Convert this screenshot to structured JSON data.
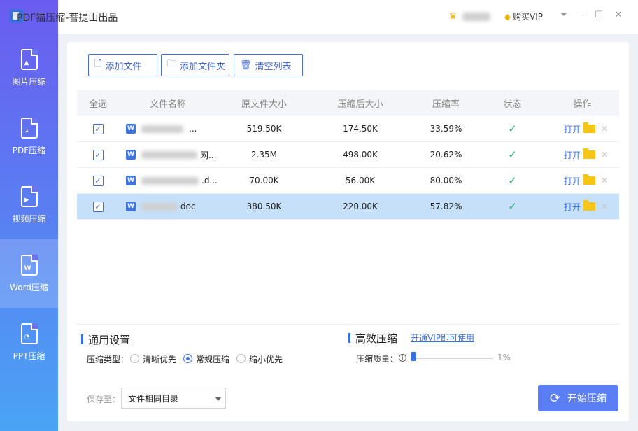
{
  "app": {
    "title": "PDF猫压缩-菩提山出品"
  },
  "topbar": {
    "user_name": "",
    "buy_vip": "购买VIP"
  },
  "sidebar": {
    "items": [
      {
        "label": "图片压缩",
        "icon": "image-file-icon"
      },
      {
        "label": "PDF压缩",
        "icon": "pdf-file-icon"
      },
      {
        "label": "视频压缩",
        "icon": "video-file-icon"
      },
      {
        "label": "Word压缩",
        "icon": "word-file-icon",
        "active": true
      },
      {
        "label": "PPT压缩",
        "icon": "ppt-file-icon"
      }
    ]
  },
  "toolbar": {
    "add_file": "添加文件",
    "add_folder": "添加文件夹",
    "clear_list": "清空列表"
  },
  "table": {
    "headers": [
      "全选",
      "文件名称",
      "原文件大小",
      "压缩后大小",
      "压缩率",
      "状态",
      "操作"
    ],
    "rows": [
      {
        "name": "...",
        "original": "519.50K",
        "compressed": "174.50K",
        "ratio": "33.59%",
        "status": "done",
        "open": "打开",
        "checked": true,
        "selected": false
      },
      {
        "name": "网...",
        "original": "2.35M",
        "compressed": "498.00K",
        "ratio": "20.62%",
        "status": "done",
        "open": "打开",
        "checked": true,
        "selected": false
      },
      {
        "name": ".d...",
        "original": "70.00K",
        "compressed": "56.00K",
        "ratio": "80.00%",
        "status": "done",
        "open": "打开",
        "checked": true,
        "selected": false
      },
      {
        "name": "doc",
        "original": "380.50K",
        "compressed": "220.00K",
        "ratio": "57.82%",
        "status": "done",
        "open": "打开",
        "checked": true,
        "selected": true
      }
    ]
  },
  "settings": {
    "general_title": "通用设置",
    "type_label": "压缩类型：",
    "options": [
      "清晰优先",
      "常规压缩",
      "缩小优先"
    ],
    "selected_option": "常规压缩",
    "efficient_title": "高效压缩",
    "vip_link": "开通VIP即可使用",
    "quality_label": "压缩质量：",
    "quality_value": "1%",
    "quality_fraction": 0.01
  },
  "footer": {
    "save_label": "保存至：",
    "save_target": "文件相同目录",
    "start_button": "开始压缩"
  },
  "colors": {
    "accent": "#3a6fe0",
    "selected_row": "#c5e0f8",
    "success": "#2bb673",
    "start_button": "#5b7ef4"
  }
}
